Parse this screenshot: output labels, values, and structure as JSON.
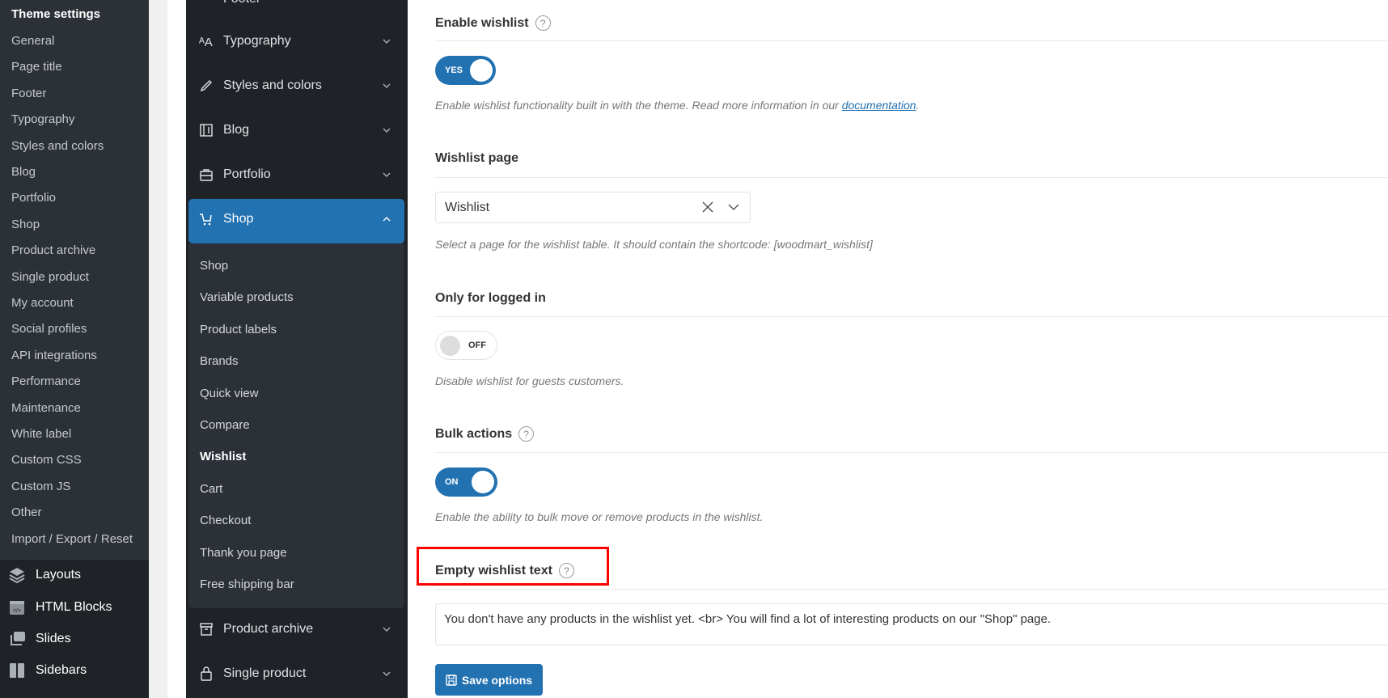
{
  "sidebar": {
    "title": "Theme settings",
    "items": [
      "General",
      "Page title",
      "Footer",
      "Typography",
      "Styles and colors",
      "Blog",
      "Portfolio",
      "Shop",
      "Product archive",
      "Single product",
      "My account",
      "Social profiles",
      "API integrations",
      "Performance",
      "Maintenance",
      "White label",
      "Custom CSS",
      "Custom JS",
      "Other",
      "Import / Export / Reset"
    ],
    "menu": [
      {
        "label": "Layouts",
        "icon": "layers-icon"
      },
      {
        "label": "HTML Blocks",
        "icon": "code-block-icon"
      },
      {
        "label": "Slides",
        "icon": "slides-icon"
      },
      {
        "label": "Sidebars",
        "icon": "sidebar-icon"
      }
    ]
  },
  "settings_nav": {
    "partial_top": "Footer",
    "groups": [
      {
        "label": "Typography",
        "icon": "typography-icon"
      },
      {
        "label": "Styles and colors",
        "icon": "brush-icon"
      },
      {
        "label": "Blog",
        "icon": "blog-icon"
      },
      {
        "label": "Portfolio",
        "icon": "briefcase-icon"
      }
    ],
    "active": {
      "label": "Shop",
      "icon": "cart-icon"
    },
    "sub_items": [
      "Shop",
      "Variable products",
      "Product labels",
      "Brands",
      "Quick view",
      "Compare",
      "Wishlist",
      "Cart",
      "Checkout",
      "Thank you page",
      "Free shipping bar"
    ],
    "current_sub": "Wishlist",
    "after": [
      {
        "label": "Product archive",
        "icon": "archive-icon"
      },
      {
        "label": "Single product",
        "icon": "bag-icon"
      }
    ]
  },
  "main": {
    "enable_wishlist": {
      "label": "Enable wishlist",
      "toggle": "YES",
      "value": true,
      "desc": "Enable wishlist functionality built in with the theme. Read more information in our ",
      "link": "documentation",
      "desc_end": "."
    },
    "wishlist_page": {
      "label": "Wishlist page",
      "value": "Wishlist",
      "desc": "Select a page for the wishlist table. It should contain the shortcode: [woodmart_wishlist]"
    },
    "only_logged_in": {
      "label": "Only for logged in",
      "toggle": "OFF",
      "value": false,
      "desc": "Disable wishlist for guests customers."
    },
    "bulk_actions": {
      "label": "Bulk actions",
      "toggle": "ON",
      "value": true,
      "desc": "Enable the ability to bulk move or remove products in the wishlist."
    },
    "empty_text": {
      "label": "Empty wishlist text",
      "value": "You don't have any products in the wishlist yet. <br> You will find a lot of interesting products on our \"Shop\" page."
    },
    "help": "?",
    "save_label": "Save options"
  },
  "colors": {
    "accent": "#2271b1",
    "highlight": "#ff0000"
  }
}
